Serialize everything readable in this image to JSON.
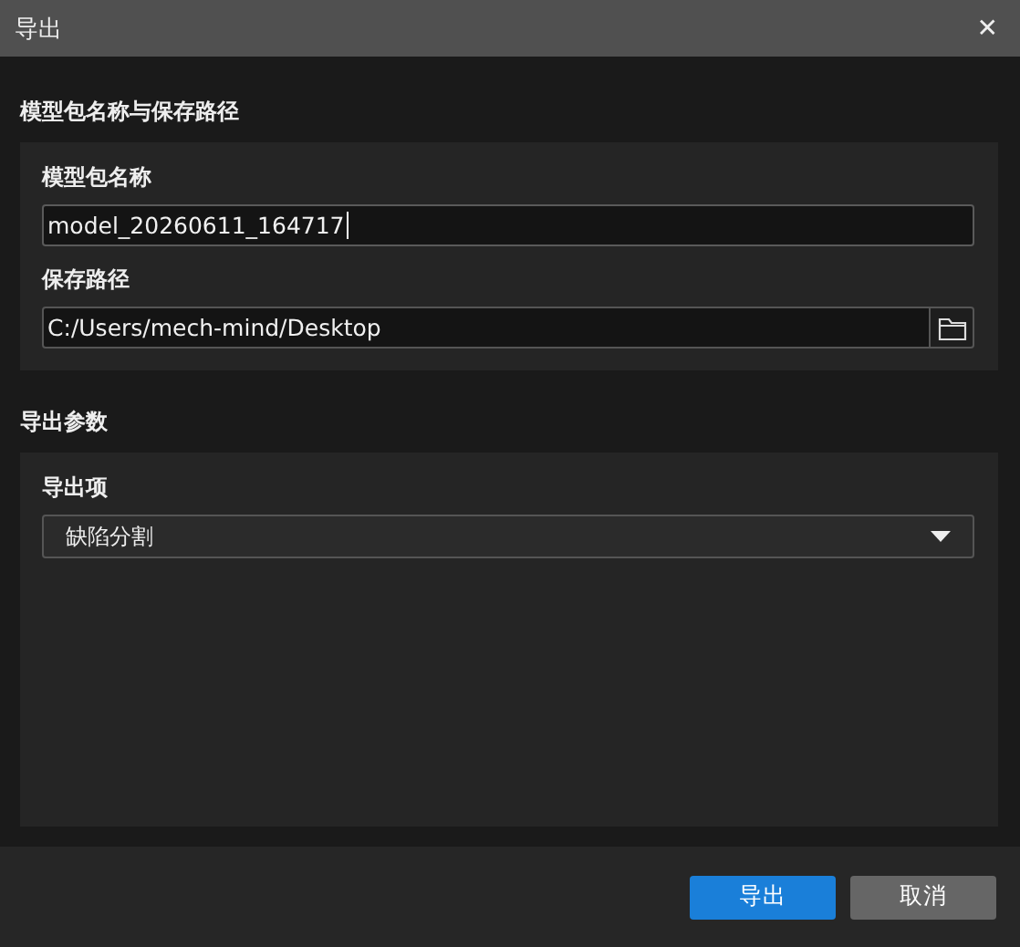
{
  "window": {
    "title": "导出",
    "close": "✕"
  },
  "sections": [
    {
      "title": "模型包名称与保存路径",
      "fields": [
        {
          "kind": "text",
          "label": "模型包名称",
          "value": "model_20260611_164717",
          "focused": true
        },
        {
          "kind": "path",
          "label": "保存路径",
          "value": "C:/Users/mech-mind/Desktop",
          "focused": false
        }
      ]
    },
    {
      "title": "导出参数",
      "fields": [
        {
          "kind": "select",
          "label": "导出项",
          "value": "缺陷分割",
          "focused": false
        }
      ]
    }
  ],
  "buttons": [
    {
      "label": "导出",
      "kind": "primary"
    },
    {
      "label": "取消",
      "kind": "secondary"
    }
  ]
}
